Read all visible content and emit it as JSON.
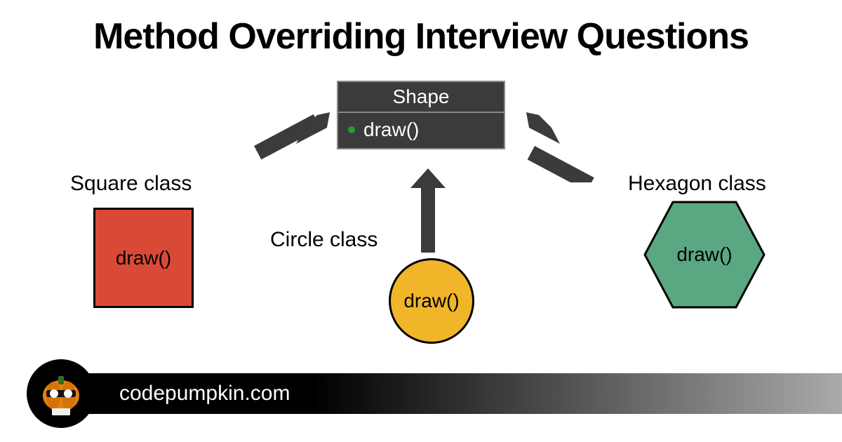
{
  "title": "Method Overriding Interview Questions",
  "shape_class": {
    "name": "Shape",
    "method": "draw()"
  },
  "square": {
    "label": "Square class",
    "method": "draw()"
  },
  "circle": {
    "label": "Circle class",
    "method": "draw()"
  },
  "hexagon": {
    "label": "Hexagon class",
    "method": "draw()"
  },
  "footer_text": "codepumpkin.com",
  "colors": {
    "arrow": "#3b3b3b",
    "square": "#d94a36",
    "circle": "#f1b52a",
    "hexagon": "#5aa881",
    "box": "#3b3b3b"
  }
}
